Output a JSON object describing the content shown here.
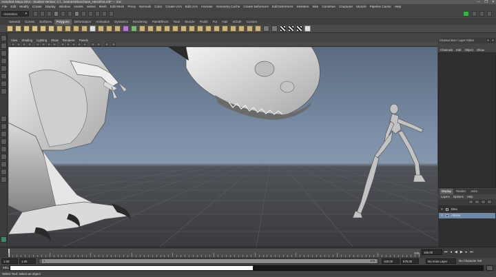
{
  "window": {
    "title": "Autodesk Maya 2014 - Student Version: C:\\...\\scenes\\DinoChase_HeroShot.mb* --- Zoc",
    "controls": [
      "—",
      "❐",
      "✕"
    ]
  },
  "menubar": [
    "File",
    "Edit",
    "Modify",
    "Create",
    "Display",
    "Window",
    "Assets",
    "Select",
    "Mesh",
    "Edit Mesh",
    "Proxy",
    "Normals",
    "Color",
    "Create UVs",
    "Edit UVs",
    "Animate",
    "Geometry Cache",
    "Create Deformers",
    "Edit Deformers",
    "Skeleton",
    "Skin",
    "Constrain",
    "Character",
    "Muscle",
    "Pipeline Cache",
    "Help"
  ],
  "statusline": {
    "mode": "Animation"
  },
  "shelf": {
    "tabs": [
      "General",
      "Curves",
      "Surfaces",
      "Polygons",
      "Deformation",
      "Animation",
      "Dynamics",
      "Rendering",
      "PaintEffects",
      "Toon",
      "Muscle",
      "Fluids",
      "Fur",
      "Hair",
      "nCloth",
      "Custom"
    ],
    "active_tab": "Polygons"
  },
  "viewport": {
    "menu": [
      "View",
      "Shading",
      "Lighting",
      "Show",
      "Renderer",
      "Panels"
    ]
  },
  "channel_box": {
    "header": "Channel Box / Layer Editor",
    "menu": [
      "Channels",
      "Edit",
      "Object",
      "Show"
    ]
  },
  "layer_editor": {
    "tabs": [
      "Display",
      "Render",
      "Anim"
    ],
    "active_tab": "Display",
    "menu": [
      "Layers",
      "Options",
      "Help"
    ],
    "rows": [
      {
        "v": "V",
        "name": "Dino",
        "selected": false
      },
      {
        "v": "V",
        "name": "Athlete",
        "selected": true
      }
    ]
  },
  "timeline": {
    "current_frame": "1",
    "end_label": "100",
    "field_value": "155.00",
    "progress": 0.0
  },
  "range": {
    "start": "1.00",
    "start2": "1.00",
    "inner_start": "1",
    "inner_end": "100",
    "end": "100.00",
    "end2": "876.00",
    "anim_layer": "No Anim Layer",
    "character_set": "No Character Set"
  },
  "command_line": {
    "label": "MEL"
  },
  "help_line": {
    "text": "Select Tool: select an object"
  }
}
